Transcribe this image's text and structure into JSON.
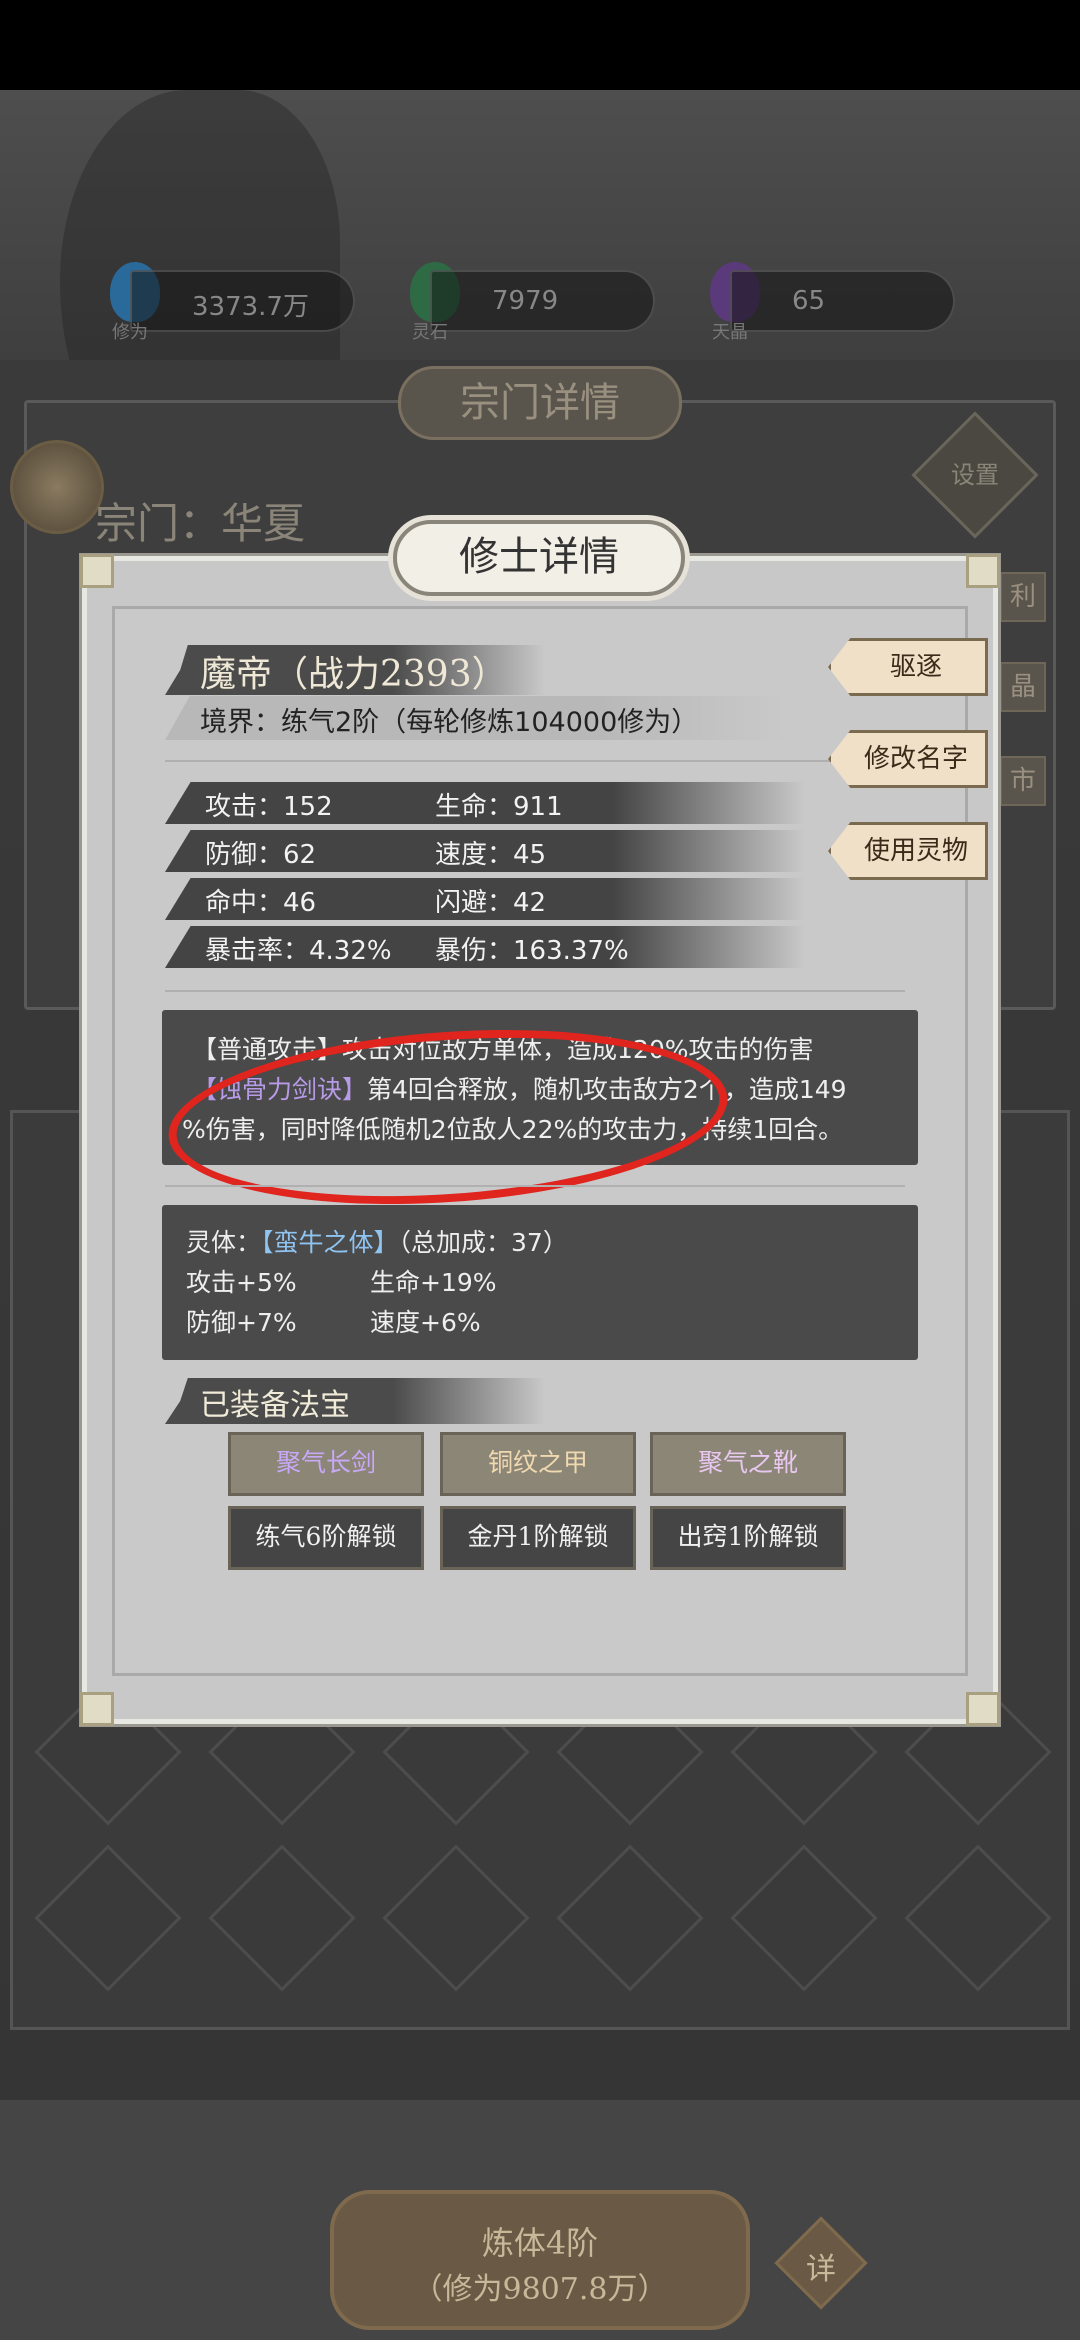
{
  "resources": [
    {
      "icon": "cultivation-flame-icon",
      "value": "3373.7万",
      "label": "修为",
      "color": "#2a8ac8"
    },
    {
      "icon": "spirit-stone-icon",
      "value": "7979",
      "label": "灵石",
      "color": "#3a9a5a"
    },
    {
      "icon": "crystal-icon",
      "value": "65",
      "label": "天晶",
      "color": "#8a4ac8"
    }
  ],
  "sect": {
    "title": "宗门详情",
    "name": "宗门：华夏",
    "settings": "设置",
    "side_tabs": [
      "利",
      "晶",
      "市"
    ]
  },
  "modal": {
    "title": "修士详情",
    "name_line": "魔帝（战力2393）",
    "realm": "境界：练气2阶（每轮修炼104000修为）",
    "actions": {
      "expel": "驱逐",
      "rename": "修改名字",
      "use_item": "使用灵物"
    },
    "stats": [
      [
        "攻击：152",
        "生命：911"
      ],
      [
        "防御：62",
        "速度：45"
      ],
      [
        "命中：46",
        "闪避：42"
      ],
      [
        "暴击率：4.32%",
        "暴伤：163.37%"
      ]
    ],
    "skills": {
      "line1_tag": "【普通攻击】",
      "line1_text": "攻击对位敌方单体，造成120%攻击的伤害",
      "line2_tag": "【蚀骨力剑诀】",
      "line2_text": "第4回合释放，随机攻击敌方2个，造成149",
      "line3_text": "%伤害，同时降低随机2位敌人22%的攻击力，持续1回合。"
    },
    "spirit": {
      "label": "灵体：",
      "name": "【蛮牛之体】",
      "total": "（总加成：37）",
      "bonuses": [
        "攻击+5%",
        "生命+19%",
        "防御+7%",
        "速度+6%"
      ]
    },
    "equipment": {
      "title": "已装备法宝",
      "items": [
        {
          "name": "聚气长剑",
          "color": "#c8a8f8"
        },
        {
          "name": "铜纹之甲",
          "color": "#f0d8b0"
        },
        {
          "name": "聚气之靴",
          "color": "#e8c8f0"
        }
      ],
      "locks": [
        "练气6阶解锁",
        "金丹1阶解锁",
        "出窍1阶解锁"
      ]
    }
  },
  "bottom": {
    "line1": "炼体4阶",
    "line2": "（修为9807.8万）",
    "detail": "详"
  }
}
